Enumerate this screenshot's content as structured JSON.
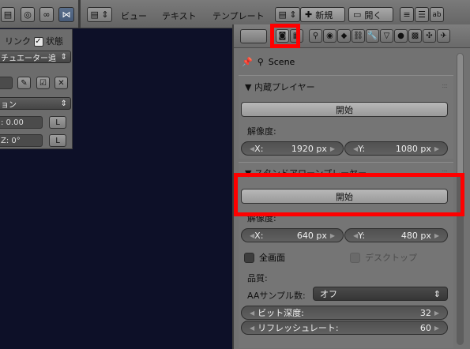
{
  "header": {
    "menus": [
      "ビュー",
      "テキスト",
      "テンプレート"
    ],
    "new_label": "新規",
    "open_label": "開く",
    "run_label": "ab"
  },
  "left_panel": {
    "link_label": "リンク",
    "state_label": "状態",
    "actuator_select": "チュエーター追",
    "mode_select": "ョン",
    "value_field": ": 0.00",
    "value_l": "L",
    "z_field": "Z:  0°",
    "z_l": "L"
  },
  "props": {
    "breadcrumb": "Scene",
    "embedded_player": {
      "title": "内蔵プレイヤー",
      "start_label": "開始",
      "resolution_label": "解像度:",
      "x_label": "X:",
      "x_value": "1920 px",
      "y_label": "Y:",
      "y_value": "1080 px"
    },
    "standalone_player": {
      "title": "スタンドアローンプレーヤー",
      "start_label": "開始",
      "resolution_label": "解像度:",
      "x_label": "X:",
      "x_value": "640 px",
      "y_label": "Y:",
      "y_value": "480 px",
      "fullscreen_label": "全画面",
      "desktop_label": "デスクトップ",
      "quality_label": "品質:",
      "aa_label": "AAサンプル数:",
      "aa_value": "オフ",
      "bit_depth_label": "ビット深度:",
      "bit_depth_value": "32",
      "refresh_label": "リフレッシュレート:",
      "refresh_value": "60"
    }
  },
  "colors": {
    "highlight": "#ff0000",
    "panel_bg": "#727272",
    "field_bg": "#505050"
  }
}
